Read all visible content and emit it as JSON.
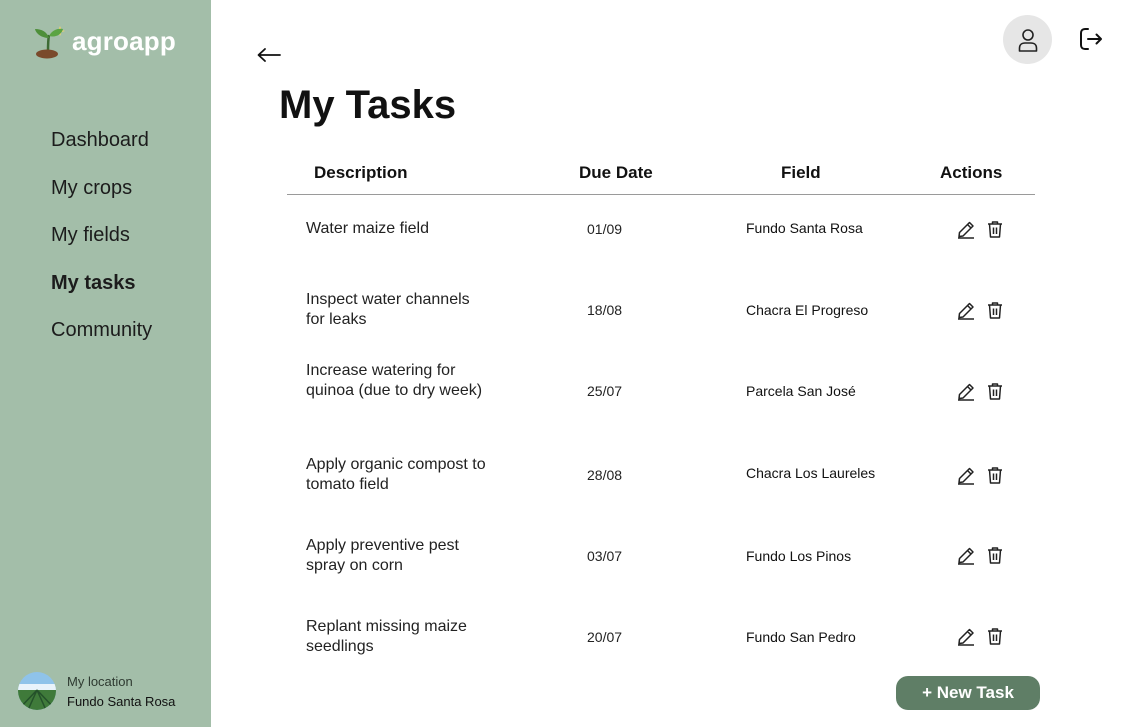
{
  "app": {
    "name": "agroapp"
  },
  "sidebar": {
    "items": [
      {
        "label": "Dashboard",
        "active": false
      },
      {
        "label": "My crops",
        "active": false
      },
      {
        "label": "My fields",
        "active": false
      },
      {
        "label": "My tasks",
        "active": true
      },
      {
        "label": "Community",
        "active": false
      }
    ],
    "location": {
      "label": "My location",
      "value": "Fundo Santa Rosa"
    }
  },
  "header": {
    "back_icon": "arrow-left-icon",
    "profile_icon": "user-icon",
    "logout_icon": "logout-icon"
  },
  "page": {
    "title": "My Tasks"
  },
  "table": {
    "headers": {
      "description": "Description",
      "due_date": "Due Date",
      "field": "Field",
      "actions": "Actions"
    },
    "rows": [
      {
        "description": "Water maize field",
        "due_date": "01/09",
        "field": "Fundo Santa Rosa"
      },
      {
        "description": "Inspect water channels for leaks",
        "due_date": "18/08",
        "field": "Chacra El Progreso"
      },
      {
        "description": "Increase watering for quinoa (due to dry week)",
        "due_date": "25/07",
        "field": "Parcela San José"
      },
      {
        "description": "Apply organic compost to tomato field",
        "due_date": "28/08",
        "field": "Chacra Los Laureles"
      },
      {
        "description": "Apply preventive pest spray on corn",
        "due_date": "03/07",
        "field": "Fundo Los Pinos"
      },
      {
        "description": "Replant missing maize seedlings",
        "due_date": "20/07",
        "field": "Fundo San Pedro"
      }
    ]
  },
  "actions": {
    "new_task_label": "+ New Task"
  },
  "colors": {
    "sidebar": "#a3bea9",
    "accent": "#5f7e66",
    "profile_bg": "#e6e6e6"
  }
}
